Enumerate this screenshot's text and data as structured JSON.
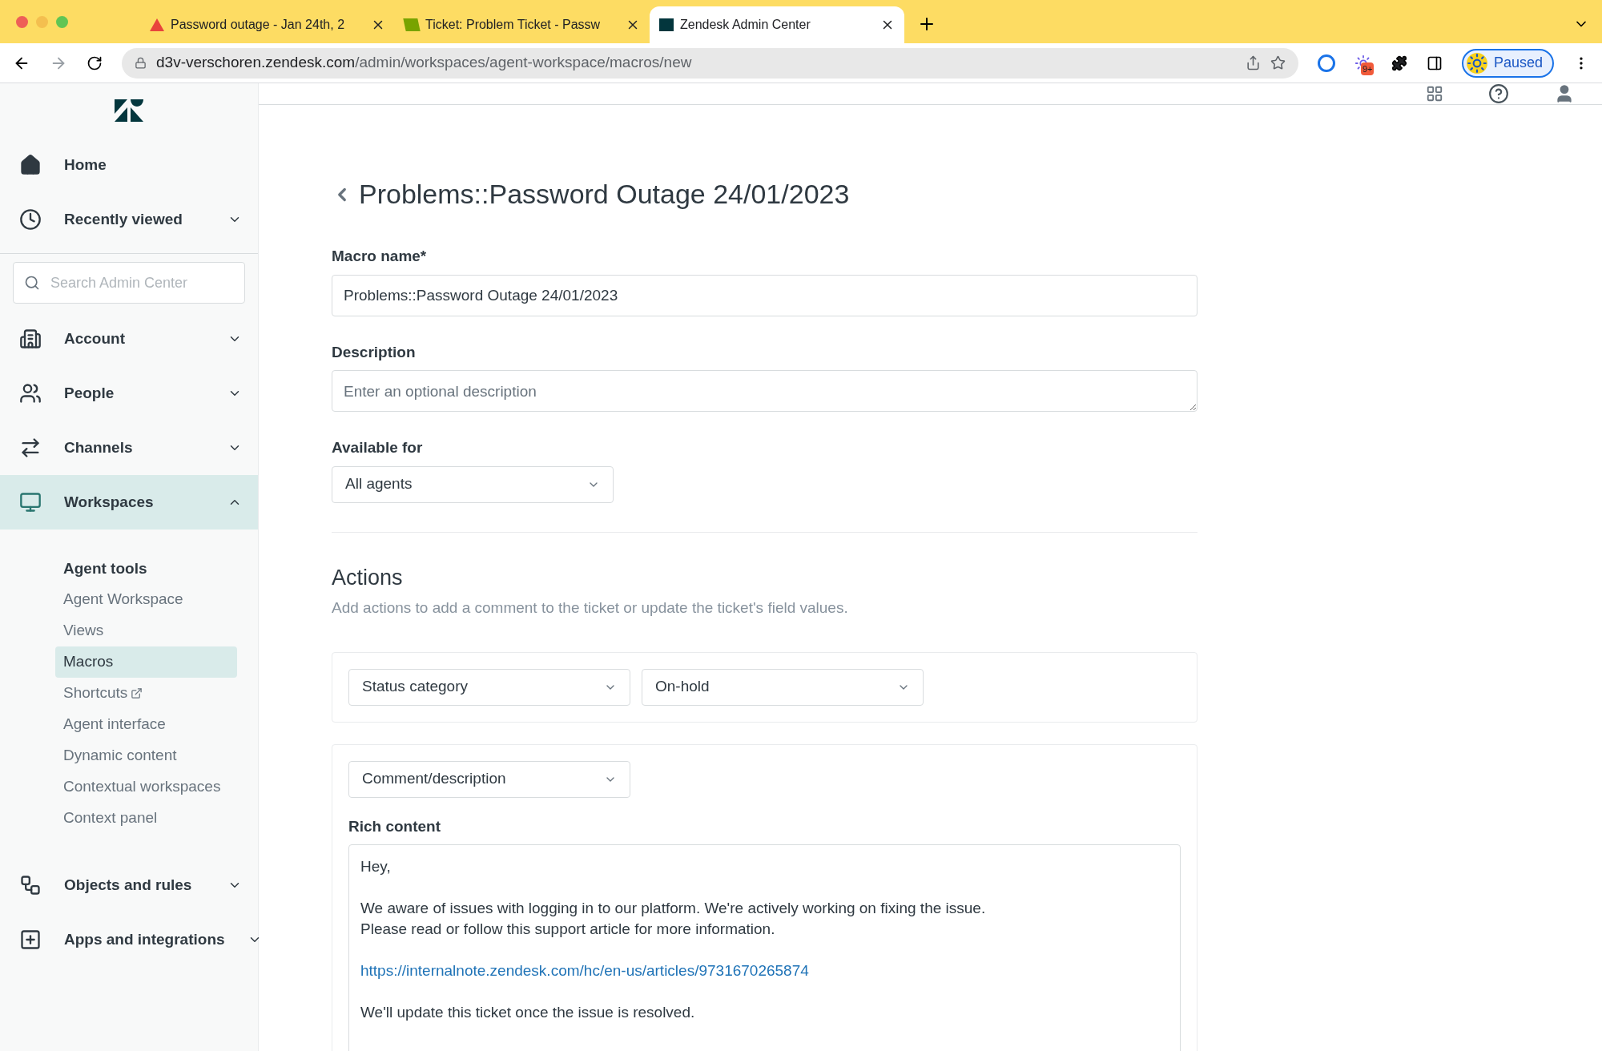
{
  "browser": {
    "tabs": [
      {
        "title": "Password outage - Jan 24th, 2",
        "selected": false
      },
      {
        "title": "Ticket: Problem Ticket - Passw",
        "selected": false
      },
      {
        "title": "Zendesk Admin Center",
        "selected": true
      }
    ],
    "url_host": "d3v-verschoren.zendesk.com",
    "url_path": "/admin/workspaces/agent-workspace/macros/new",
    "extension_badge": "9+",
    "profile_label": "Paused"
  },
  "sidebar": {
    "items": [
      {
        "label": "Home",
        "kind": "link",
        "selected": false
      },
      {
        "label": "Recently viewed",
        "kind": "group",
        "expanded": false,
        "selected": false
      },
      {
        "kind": "search",
        "placeholder": "Search Admin Center"
      },
      {
        "label": "Account",
        "kind": "group",
        "expanded": false,
        "selected": false
      },
      {
        "label": "People",
        "kind": "group",
        "expanded": false,
        "selected": false
      },
      {
        "label": "Channels",
        "kind": "group",
        "expanded": false,
        "selected": false
      },
      {
        "label": "Workspaces",
        "kind": "group",
        "expanded": true,
        "selected": true,
        "section": "Agent tools",
        "children": [
          {
            "label": "Agent Workspace",
            "selected": false,
            "external": false
          },
          {
            "label": "Views",
            "selected": false,
            "external": false
          },
          {
            "label": "Macros",
            "selected": true,
            "external": false
          },
          {
            "label": "Shortcuts",
            "selected": false,
            "external": true
          },
          {
            "label": "Agent interface",
            "selected": false,
            "external": false
          },
          {
            "label": "Dynamic content",
            "selected": false,
            "external": false
          },
          {
            "label": "Contextual workspaces",
            "selected": false,
            "external": false
          },
          {
            "label": "Context panel",
            "selected": false,
            "external": false
          }
        ]
      },
      {
        "label": "Objects and rules",
        "kind": "group",
        "expanded": false,
        "selected": false
      },
      {
        "label": "Apps and integrations",
        "kind": "group",
        "expanded": false,
        "selected": false
      }
    ]
  },
  "page": {
    "title": "Problems::Password Outage 24/01/2023",
    "macro_name": {
      "label": "Macro name*",
      "value": "Problems::Password Outage 24/01/2023"
    },
    "description": {
      "label": "Description",
      "placeholder": "Enter an optional description"
    },
    "available_for": {
      "label": "Available for",
      "value": "All agents"
    },
    "actions": {
      "heading": "Actions",
      "hint": "Add actions to add a comment to the ticket or update the ticket's field values.",
      "items": [
        {
          "kind": "field",
          "field": "Status category",
          "value": "On-hold"
        },
        {
          "kind": "comment",
          "field": "Comment/description",
          "content_label": "Rich content",
          "paragraphs": [
            {
              "kind": "text",
              "lines": [
                "Hey,"
              ]
            },
            {
              "kind": "text",
              "lines": [
                "We aware of issues with logging in to our platform. We're actively working on fixing the issue.",
                "Please read or follow this support article for more information."
              ]
            },
            {
              "kind": "link",
              "lines": [
                "https://internalnote.zendesk.com/hc/en-us/articles/9731670265874"
              ]
            },
            {
              "kind": "text",
              "lines": [
                "We'll update this ticket once the issue is resolved."
              ]
            }
          ]
        }
      ]
    }
  }
}
